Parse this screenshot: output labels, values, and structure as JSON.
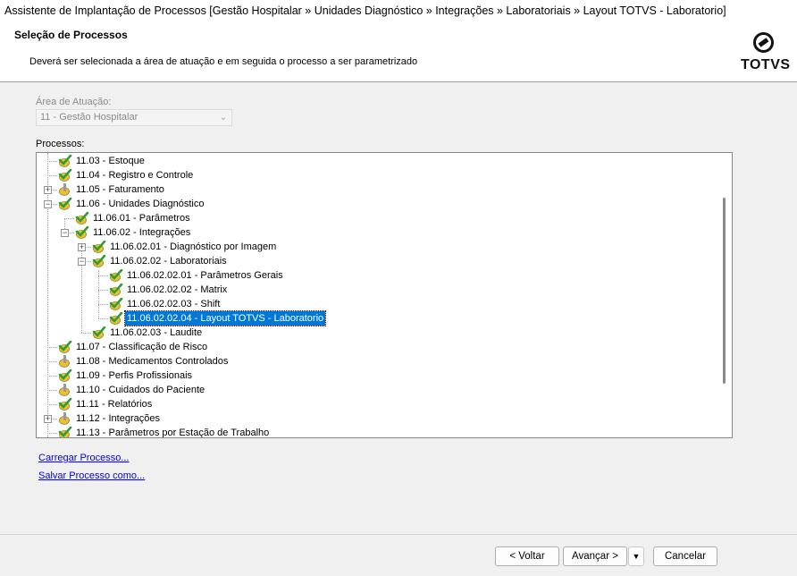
{
  "window": {
    "title": "Assistente de Implantação de Processos [Gestão Hospitalar » Unidades Diagnóstico » Integrações » Laboratoriais » Layout TOTVS - Laboratorio]"
  },
  "header": {
    "title": "Seleção de Processos",
    "subtitle": "Deverá ser selecionada a área de atuação e em seguida o processo a ser parametrizado",
    "logo_text": "TOTVS"
  },
  "area": {
    "label": "Área de Atuação:",
    "value": "11 - Gestão Hospitalar"
  },
  "processes": {
    "label": "Processos:",
    "items": [
      {
        "label": "11.03 - Estoque",
        "status": "check"
      },
      {
        "label": "11.04 - Registro e Controle",
        "status": "check"
      },
      {
        "label": "11.05 - Faturamento",
        "status": "partial",
        "expander": "+"
      },
      {
        "label": "11.06 - Unidades Diagnóstico",
        "status": "check",
        "expander": "-"
      },
      {
        "label": "11.06.01 - Parâmetros",
        "status": "check"
      },
      {
        "label": "11.06.02 - Integrações",
        "status": "check",
        "expander": "-"
      },
      {
        "label": "11.06.02.01 - Diagnóstico por Imagem",
        "status": "check",
        "expander": "+"
      },
      {
        "label": "11.06.02.02 - Laboratoriais",
        "status": "check",
        "expander": "-"
      },
      {
        "label": "11.06.02.02.01 - Parâmetros Gerais",
        "status": "check"
      },
      {
        "label": "11.06.02.02.02 - Matrix",
        "status": "check"
      },
      {
        "label": "11.06.02.02.03 - Shift",
        "status": "check"
      },
      {
        "label": "11.06.02.02.04 - Layout TOTVS - Laboratorio",
        "status": "check",
        "selected": true
      },
      {
        "label": "11.06.02.03 - Laudite",
        "status": "check"
      },
      {
        "label": "11.07 - Classificação de Risco",
        "status": "check"
      },
      {
        "label": "11.08 - Medicamentos Controlados",
        "status": "partial"
      },
      {
        "label": "11.09 - Perfis Profissionais",
        "status": "check"
      },
      {
        "label": "11.10 - Cuidados do Paciente",
        "status": "partial"
      },
      {
        "label": "11.11 - Relatórios",
        "status": "check"
      },
      {
        "label": "11.12 - Integrações",
        "status": "partial",
        "expander": "+"
      },
      {
        "label": "11.13 - Parâmetros por Estação de Trabalho",
        "status": "check"
      }
    ]
  },
  "links": {
    "load": "Carregar Processo...",
    "save_as": "Salvar Processo como..."
  },
  "buttons": {
    "back": "< Voltar",
    "next": "Avançar >",
    "cancel": "Cancelar"
  },
  "colors": {
    "selection": "#0078d7",
    "check_green": "#2e9d2e",
    "icon_yellow": "#e8c13a"
  }
}
